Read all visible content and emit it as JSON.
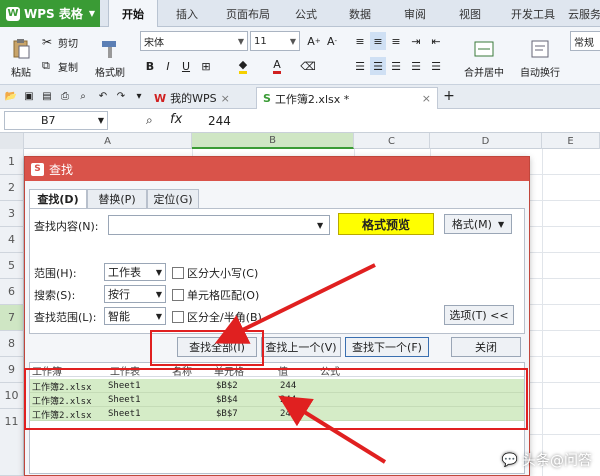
{
  "app": {
    "name": "WPS 表格",
    "logo": "W"
  },
  "ribbon_tabs": [
    "开始",
    "插入",
    "页面布局",
    "公式",
    "数据",
    "审阅",
    "视图",
    "开发工具",
    "云服务"
  ],
  "ribbon": {
    "paste": "粘贴",
    "cut": "剪切",
    "copy": "复制",
    "format_painter": "格式刷",
    "font_name": "宋体",
    "font_size": "11",
    "merge_center": "合并居中",
    "wrap_text": "自动换行",
    "normal": "常规"
  },
  "doc_tabs": {
    "mywps": "我的WPS",
    "workbook": "工作簿2.xlsx *"
  },
  "formula_bar": {
    "cell_ref": "B7",
    "fx": "fx",
    "value": "244"
  },
  "columns": [
    "A",
    "B",
    "C",
    "D",
    "E"
  ],
  "rows": [
    "1",
    "2",
    "3",
    "4",
    "5",
    "6",
    "7",
    "8",
    "9",
    "10",
    "11"
  ],
  "dialog": {
    "title": "查找",
    "title_icon": "S",
    "tabs": [
      "查找(D)",
      "替换(P)",
      "定位(G)"
    ],
    "find_label": "查找内容(N):",
    "find_value": "",
    "format_preview": "格式预览",
    "format_button": "格式(M)",
    "scope_label": "范围(H):",
    "scope_value": "工作表",
    "search_label": "搜索(S):",
    "search_value": "按行",
    "lookin_label": "查找范围(L):",
    "lookin_value": "智能",
    "match_case": "区分大小写(C)",
    "match_cell": "单元格匹配(O)",
    "match_width": "区分全/半角(B)",
    "options_button": "选项(T) <<",
    "find_all": "查找全部(I)",
    "find_prev": "查找上一个(V)",
    "find_next": "查找下一个(F)",
    "close": "关闭",
    "results_headers": [
      "工作簿",
      "工作表",
      "名称",
      "单元格",
      "值",
      "公式"
    ],
    "results": [
      {
        "book": "工作簿2.xlsx",
        "sheet": "Sheet1",
        "cell": "$B$2",
        "value": "244"
      },
      {
        "book": "工作簿2.xlsx",
        "sheet": "Sheet1",
        "cell": "$B$4",
        "value": "244"
      },
      {
        "book": "工作簿2.xlsx",
        "sheet": "Sheet1",
        "cell": "$B$7",
        "value": "244"
      }
    ]
  },
  "watermark": "头条@问答",
  "colors": {
    "accent_green": "#3a9b35",
    "dialog_red": "#d9534a",
    "annotation_red": "#e02020",
    "result_green": "#d5ecc7",
    "preview_yellow": "#ffff00"
  }
}
